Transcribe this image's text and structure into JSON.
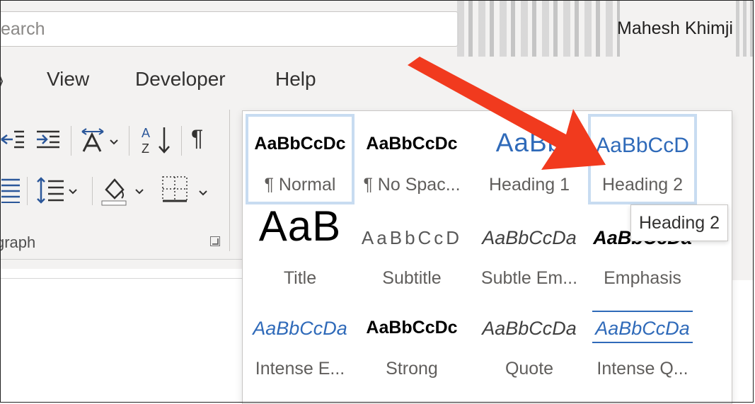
{
  "search": {
    "text": "earch"
  },
  "user": {
    "name": "Mahesh Khimji M"
  },
  "tabs": [
    "View",
    "Developer",
    "Help"
  ],
  "ribbon": {
    "group_label": "graph",
    "pilcrow": "¶"
  },
  "gallery": {
    "rows": [
      [
        {
          "preview": "AaBbCcDc",
          "name": "¶ Normal",
          "style": "p-bold",
          "state": "selected"
        },
        {
          "preview": "AaBbCcDc",
          "name": "¶ No Spac...",
          "style": "p-bold",
          "state": ""
        },
        {
          "preview": "AaBb",
          "name": "Heading 1",
          "style": "p-h1",
          "state": ""
        },
        {
          "preview": "AaBbCcD",
          "name": "Heading 2",
          "style": "p-h2",
          "state": "hovered"
        }
      ],
      [
        {
          "preview": "AaB",
          "name": "Title",
          "style": "p-title",
          "state": ""
        },
        {
          "preview": "AaBbCcD",
          "name": "Subtitle",
          "style": "p-sub",
          "state": ""
        },
        {
          "preview": "AaBbCcDa",
          "name": "Subtle Em...",
          "style": "p-subem",
          "state": ""
        },
        {
          "preview": "AaBbCcDa",
          "name": "Emphasis",
          "style": "p-em",
          "state": ""
        }
      ],
      [
        {
          "preview": "AaBbCcDa",
          "name": "Intense E...",
          "style": "p-ie",
          "state": ""
        },
        {
          "preview": "AaBbCcDc",
          "name": "Strong",
          "style": "p-bold",
          "state": ""
        },
        {
          "preview": "AaBbCcDa",
          "name": "Quote",
          "style": "p-subem",
          "state": ""
        },
        {
          "preview": "AaBbCcDa",
          "name": "Intense Q...",
          "style": "p-iq",
          "state": ""
        }
      ]
    ]
  },
  "tooltip": {
    "text": "Heading 2"
  },
  "colors": {
    "accent": "#2f6ab9",
    "arrow": "#f13a1e",
    "selection_border": "#c8dcf1"
  }
}
